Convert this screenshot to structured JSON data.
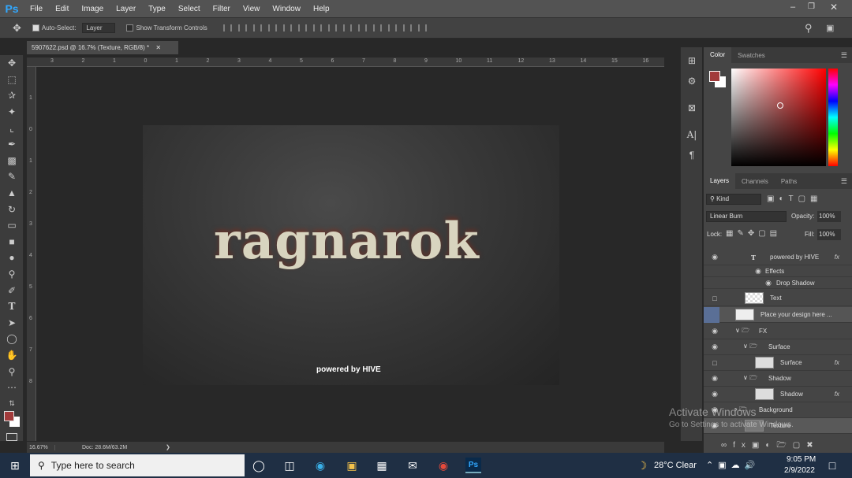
{
  "menubar": {
    "logo": "Ps",
    "items": [
      "File",
      "Edit",
      "Image",
      "Layer",
      "Type",
      "Select",
      "Filter",
      "View",
      "Window",
      "Help"
    ]
  },
  "options": {
    "auto_select": "Auto-Select:",
    "layer_select": "Layer",
    "show_transform": "Show Transform Controls"
  },
  "document": {
    "tab_title": "5907622.psd @ 16.7% (Texture, RGB/8) *"
  },
  "rulers": {
    "h": [
      "3",
      "2",
      "1",
      "0",
      "1",
      "2",
      "3",
      "4",
      "5",
      "6",
      "7",
      "8",
      "9",
      "10",
      "11",
      "12",
      "13",
      "14",
      "15",
      "16"
    ],
    "v": [
      "1",
      "0",
      "1",
      "2",
      "3",
      "4",
      "5",
      "6",
      "7",
      "8"
    ]
  },
  "artwork": {
    "title": "ragnarok",
    "tagline": "powered by HIVE"
  },
  "status": {
    "zoom": "16.67%",
    "doc": "Doc: 28.6M/63.2M"
  },
  "color_panel": {
    "tabs": [
      "Color",
      "Swatches"
    ],
    "fg": "#a23b3b",
    "bg": "#ffffff"
  },
  "layers_panel": {
    "tabs": [
      "Layers",
      "Channels",
      "Paths"
    ],
    "filter": "Kind",
    "blend_mode": "Linear Burn",
    "opacity_label": "Opacity:",
    "opacity": "100%",
    "lock_label": "Lock:",
    "fill_label": "Fill:",
    "fill": "100%",
    "layers": [
      {
        "name": "powered by HIVE",
        "fx": "fx"
      },
      {
        "name": "Effects"
      },
      {
        "name": "Drop Shadow"
      },
      {
        "name": "Text"
      },
      {
        "name": "Place your design here ..."
      },
      {
        "name": "FX"
      },
      {
        "name": "Surface"
      },
      {
        "name": "Surface",
        "fx": "fx"
      },
      {
        "name": "Shadow"
      },
      {
        "name": "Shadow",
        "fx": "fx"
      },
      {
        "name": "Background"
      },
      {
        "name": "Texture"
      }
    ]
  },
  "watermark": {
    "line1": "Activate Windows",
    "line2": "Go to Settings to activate Windows."
  },
  "taskbar": {
    "search": "Type here to search",
    "weather": "28°C  Clear",
    "time": "9:05 PM",
    "date": "2/9/2022"
  }
}
